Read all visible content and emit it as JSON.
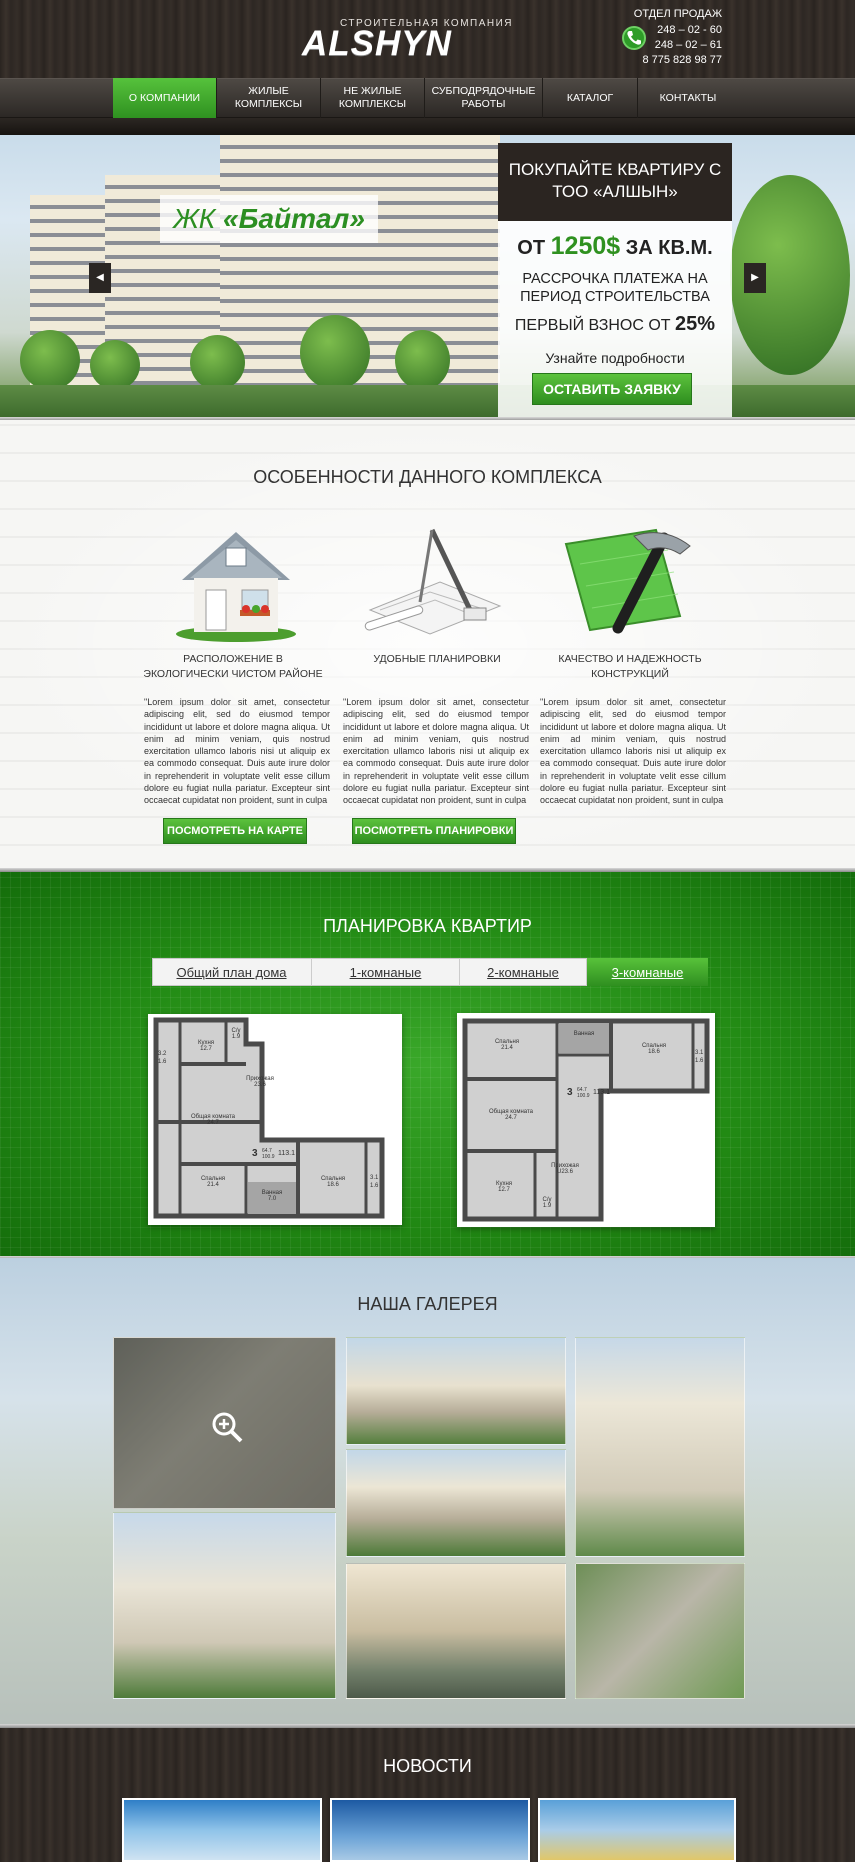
{
  "header": {
    "logo_tagline": "СТРОИТЕЛЬНАЯ КОМПАНИЯ",
    "logo_word": "ALSHYN",
    "sales_title": "ОТДЕЛ ПРОДАЖ",
    "phones": [
      "248 – 02 - 60",
      "248 – 02 – 61",
      "8 775 828 98 77"
    ]
  },
  "nav": {
    "items": [
      {
        "label": "О КОМПАНИИ"
      },
      {
        "label": "ЖИЛЫЕ КОМПЛЕКСЫ"
      },
      {
        "label": "НЕ ЖИЛЫЕ КОМПЛЕКСЫ"
      },
      {
        "label": "СУБПОДРЯДОЧНЫЕ РАБОТЫ"
      },
      {
        "label": "КАТАЛОГ"
      },
      {
        "label": "КОНТАКТЫ"
      }
    ]
  },
  "hero": {
    "title_prefix": "ЖК",
    "title_name": "«Байтал»",
    "promo_head": "ПОКУПАЙТЕ КВАРТИРУ С ТОО «АЛШЫН»",
    "price_from": "ОТ",
    "price": "1250$",
    "price_unit": "ЗА КВ.М.",
    "installment": "РАССРОЧКА ПЛАТЕЖА НА ПЕРИОД СТРОИТЕЛЬСТВА",
    "first_payment": "ПЕРВЫЙ ВЗНОС ОТ",
    "first_payment_pct": "25%",
    "details": "Узнайте подробности",
    "cta": "ОСТАВИТЬ ЗАЯВКУ"
  },
  "features": {
    "title": "ОСОБЕННОСТИ ДАННОГО КОМПЛЕКСА",
    "items": [
      {
        "name": "РАСПОЛОЖЕНИЕ В ЭКОЛОГИЧЕСКИ ЧИСТОМ РАЙОНЕ",
        "icon": "house-icon",
        "text": "\"Lorem ipsum dolor sit amet, consectetur adipiscing elit, sed do eiusmod tempor incididunt ut labore et dolore magna aliqua. Ut enim ad minim veniam, quis nostrud exercitation ullamco laboris nisi ut aliquip ex ea commodo consequat. Duis aute irure dolor in reprehenderit in voluptate velit esse cillum dolore eu fugiat nulla pariatur. Excepteur sint occaecat cupidatat non proident, sunt in culpa"
      },
      {
        "name": "УДОБНЫЕ ПЛАНИРОВКИ",
        "icon": "blueprint-icon",
        "text": "\"Lorem ipsum dolor sit amet, consectetur adipiscing elit, sed do eiusmod tempor incididunt ut labore et dolore magna aliqua. Ut enim ad minim veniam, quis nostrud exercitation ullamco laboris nisi ut aliquip ex ea commodo consequat. Duis aute irure dolor in reprehenderit in voluptate velit esse cillum dolore eu fugiat nulla pariatur. Excepteur sint occaecat cupidatat non proident, sunt in culpa"
      },
      {
        "name": "КАЧЕСТВО И НАДЕЖНОСТЬ КОНСТРУКЦИЙ",
        "icon": "hammer-icon",
        "text": "\"Lorem ipsum dolor sit amet, consectetur adipiscing elit, sed do eiusmod tempor incididunt ut labore et dolore magna aliqua. Ut enim ad minim veniam, quis nostrud exercitation ullamco laboris nisi ut aliquip ex ea commodo consequat. Duis aute irure dolor in reprehenderit in voluptate velit esse cillum dolore eu fugiat nulla pariatur. Excepteur sint occaecat cupidatat non proident, sunt in culpa"
      }
    ],
    "btn_map": "ПОСМОТРЕТЬ НА КАРТЕ",
    "btn_plans": "ПОСМОТРЕТЬ ПЛАНИРОВКИ"
  },
  "plans": {
    "title": "ПЛАНИРОВКА КВАРТИР",
    "tabs": [
      "Общий план дома",
      "1-комнаные",
      "2-комнаные",
      "3-комнаные"
    ],
    "active_tab": "3-комнаные",
    "left_rooms": [
      {
        "name": "Кухня",
        "area": "12.7"
      },
      {
        "name": "С/у",
        "area": "1.9"
      },
      {
        "name": "Прихожая",
        "area": "23.6"
      },
      {
        "name": "Общая комната",
        "area": "24.7"
      },
      {
        "name": "Спальня",
        "area": "21.4"
      },
      {
        "name": "Ванная",
        "area": "7.0"
      },
      {
        "name": "Спальня",
        "area": "18.6"
      }
    ],
    "left_side_labels": [
      "3.2",
      "1.6",
      "3.1",
      "1.6"
    ],
    "left_total": "113.1",
    "left_code": "3",
    "left_sub": [
      "64.7",
      "100.9"
    ],
    "right_rooms": [
      {
        "name": "Спальня",
        "area": "21.4"
      },
      {
        "name": "Ванная",
        "area": ""
      },
      {
        "name": "Спальня",
        "area": "18.6"
      },
      {
        "name": "Общая комната",
        "area": "24.7"
      },
      {
        "name": "Кухня",
        "area": "12.7"
      },
      {
        "name": "Прихожая",
        "area": "U23.6"
      },
      {
        "name": "С/у",
        "area": "1.9"
      }
    ],
    "right_side_labels": [
      "3.1",
      "1.6"
    ],
    "right_total": "113.1",
    "right_code": "3",
    "right_sub": [
      "64.7",
      "100.9"
    ]
  },
  "gallery": {
    "title": "НАША ГАЛЕРЕЯ"
  },
  "news": {
    "title": "НОВОСТИ"
  }
}
